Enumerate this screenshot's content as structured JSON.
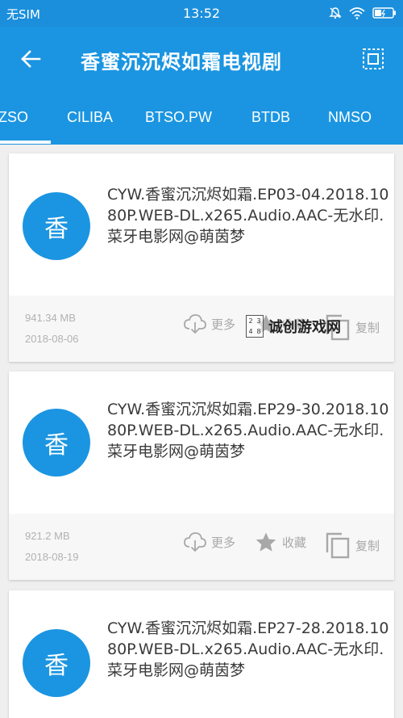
{
  "status_bar": {
    "carrier": "无SIM",
    "time": "13:52",
    "icons": [
      "mute-icon",
      "wifi-icon",
      "battery-icon"
    ]
  },
  "toolbar": {
    "title": "香蜜沉沉烬如霜电视剧",
    "back_icon": "back-arrow-icon",
    "select_icon": "select-all-icon"
  },
  "tabs": [
    {
      "label": "ZSO",
      "active": true
    },
    {
      "label": "CILIBA",
      "active": false
    },
    {
      "label": "BTSO.PW",
      "active": false
    },
    {
      "label": "BTDB",
      "active": false
    },
    {
      "label": "NMSO",
      "active": false
    }
  ],
  "results": [
    {
      "avatar": "香",
      "name": "CYW.香蜜沉沉烬如霜.EP03-04.2018.1080P.WEB-DL.x265.Audio.AAC-无水印.菜牙电影网@萌茵梦",
      "size": "941.34 MB",
      "date": "2018-08-06",
      "actions": {
        "more": "更多",
        "favorite": "收藏",
        "copy": "复制"
      }
    },
    {
      "avatar": "香",
      "name": "CYW.香蜜沉沉烬如霜.EP29-30.2018.1080P.WEB-DL.x265.Audio.AAC-无水印.菜牙电影网@萌茵梦",
      "size": "921.2 MB",
      "date": "2018-08-19",
      "actions": {
        "more": "更多",
        "favorite": "收藏",
        "copy": "复制"
      }
    },
    {
      "avatar": "香",
      "name": "CYW.香蜜沉沉烬如霜.EP27-28.2018.1080P.WEB-DL.x265.Audio.AAC-无水印.菜牙电影网@萌茵梦"
    }
  ],
  "watermark": {
    "text": "诚创游戏网",
    "logo_chars": [
      "2",
      "3",
      "4",
      "8"
    ]
  },
  "colors": {
    "primary": "#1b95e1",
    "status_bar": "#1b8fdc",
    "card_footer": "#f7f7f7",
    "meta_text": "#b2b2b2"
  }
}
